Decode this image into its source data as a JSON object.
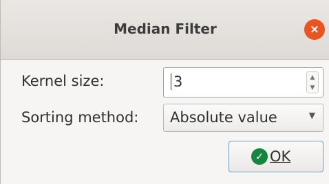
{
  "dialog": {
    "title": "Median Filter",
    "close_glyph": "×"
  },
  "form": {
    "kernel_size_label": "Kernel size:",
    "kernel_size_value": "3",
    "sorting_method_label": "Sorting method:",
    "sorting_method_value": "Absolute value"
  },
  "buttons": {
    "ok_label": "OK",
    "ok_icon": "check-circle-icon"
  },
  "colors": {
    "close_button": "#e95420",
    "ok_icon": "#15863e",
    "focus_border": "#6e9dcc"
  }
}
